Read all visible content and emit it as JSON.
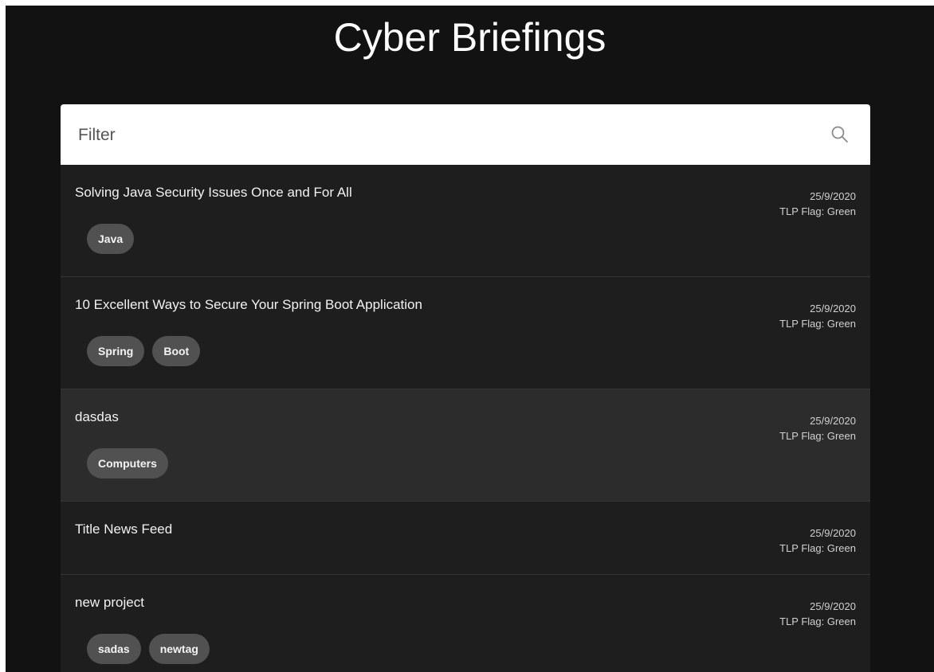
{
  "app": {
    "title": "Cyber Briefings"
  },
  "filter": {
    "placeholder": "Filter",
    "value": "",
    "icon": "search-icon"
  },
  "items": [
    {
      "title": "Solving Java Security Issues Once and For All",
      "date": "25/9/2020",
      "tlp": "TLP Flag: Green",
      "tags": [
        "Java"
      ]
    },
    {
      "title": "10 Excellent Ways to Secure Your Spring Boot Application",
      "date": "25/9/2020",
      "tlp": "TLP Flag: Green",
      "tags": [
        "Spring",
        "Boot"
      ]
    },
    {
      "title": "dasdas",
      "date": "25/9/2020",
      "tlp": "TLP Flag: Green",
      "tags": [
        "Computers"
      ]
    },
    {
      "title": "Title News Feed",
      "date": "25/9/2020",
      "tlp": "TLP Flag: Green",
      "tags": []
    },
    {
      "title": "new project",
      "date": "25/9/2020",
      "tlp": "TLP Flag: Green",
      "tags": [
        "sadas",
        "newtag"
      ]
    }
  ],
  "colors": {
    "background": "#121212",
    "panel": "#1e1e1e",
    "hover_row": "#2c2c2c",
    "chip": "#515151",
    "text": "#f2f2f2"
  }
}
